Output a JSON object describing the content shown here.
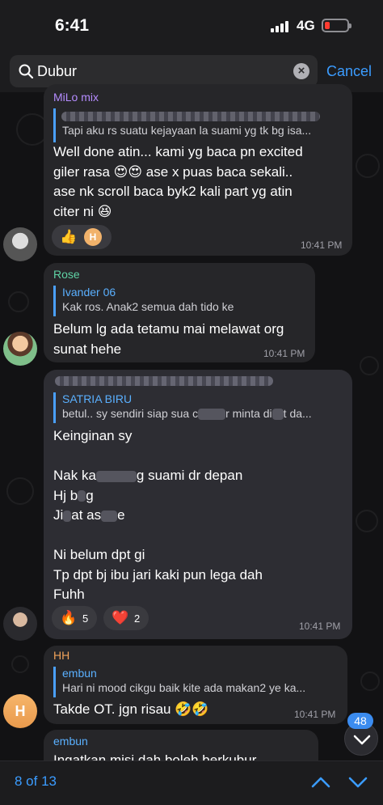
{
  "status": {
    "time": "6:41",
    "network": "4G"
  },
  "search": {
    "query": "Dubur",
    "cancel_label": "Cancel"
  },
  "messages": [
    {
      "sender": "MiLo mix",
      "reply_text": "Tapi aku rs suatu kejayaan la suami yg tk bg isa...",
      "text": "Well done atin... kami yg baca pn excited\ngiler rasa 😍😍 ase x puas baca sekali..\nase nk scroll baca byk2 kali part yg atin\nciter ni 😆",
      "reactions": [
        {
          "emoji": "👍",
          "avatar_letter": "H"
        }
      ],
      "time": "10:41 PM"
    },
    {
      "sender": "Rose",
      "reply_name": "Ivander 06",
      "reply_text": "Kak ros. Anak2 semua dah tido ke",
      "text": "Belum lg ada tetamu mai melawat org\nsunat hehe",
      "time": "10:41 PM"
    },
    {
      "reply_name": "SATRIA BIRU",
      "reply_text": "betul.. sy sendiri siap sua c",
      "reply_text_2": "r minta di",
      "reply_text_3": "t da...",
      "line1": "Keinginan sy",
      "line2a": "Nak ka",
      "line2b": "g suami dr depan",
      "line3a": "Hj b",
      "line3b": "g",
      "line4a": "Ji",
      "line4b": "at as",
      "line4c": "e",
      "line5": "Ni belum dpt gi",
      "line6": "Tp dpt bj ibu jari kaki pun lega dah",
      "line7": "Fuhh",
      "reactions": [
        {
          "emoji": "🔥",
          "count": "5"
        },
        {
          "emoji": "❤️",
          "count": "2"
        }
      ],
      "time": "10:41 PM"
    },
    {
      "sender": "HH",
      "reply_name": "embun",
      "reply_text": "Hari ni mood cikgu baik kite ada makan2 ye ka...",
      "text": "Takde OT. jgn risau 🤣🤣",
      "time": "10:41 PM",
      "avatar_letter": "H"
    },
    {
      "sender": "embun",
      "text": "Ingatkan misi dah boleh berkubur"
    }
  ],
  "unread_count": "48",
  "search_counter": "8 of 13",
  "colors": {
    "accent": "#3b9cff",
    "bubble": "#262629",
    "reply_bar": "#4aa0ff"
  }
}
